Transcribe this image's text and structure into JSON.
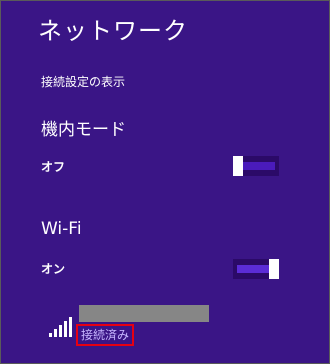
{
  "panel": {
    "title": "ネットワーク",
    "show_connection_settings": "接続設定の表示",
    "background_color": "#3a1586",
    "highlight_color": "#e60012"
  },
  "airplane_mode": {
    "label": "機内モード",
    "state": "オフ",
    "enabled": false
  },
  "wifi": {
    "label": "Wi-Fi",
    "state": "オン",
    "enabled": true
  },
  "networks": [
    {
      "name_redacted": true,
      "status": "接続済み",
      "icon": "wifi-signal-icon"
    }
  ]
}
